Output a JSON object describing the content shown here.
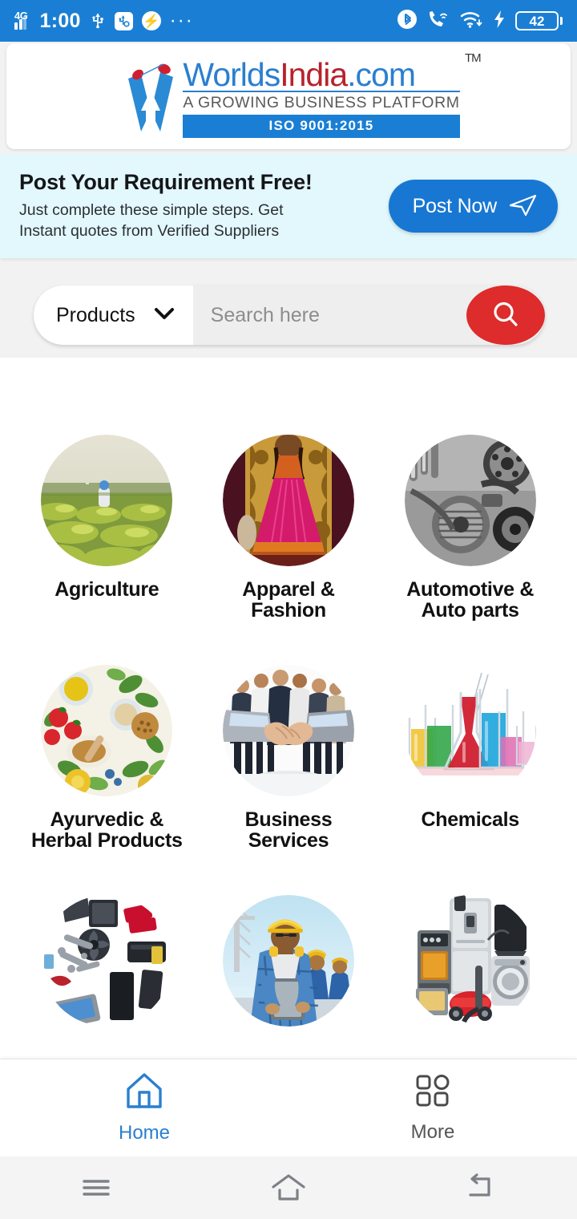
{
  "status_bar": {
    "network_type": "4G",
    "time": "1:00",
    "battery_level": "42",
    "overflow": "···",
    "icons": [
      "signal-icon",
      "usb-icon",
      "usb-debugging-icon",
      "messenger-icon",
      "overflow-dots-icon",
      "bluetooth-icon",
      "wifi-calling-icon",
      "wifi-icon",
      "charging-bolt-icon",
      "battery-icon"
    ],
    "bg_color": "#1a7fd4"
  },
  "header": {
    "brand_part1": "Worlds",
    "brand_part2": "India",
    "brand_part3": ".com",
    "trademark": "TM",
    "tagline": "A GROWING BUSINESS PLATFORM",
    "certification": "ISO 9001:2015",
    "brand_blue": "#2a7fd0",
    "brand_red": "#b8222b"
  },
  "promo": {
    "title": "Post Your Requirement Free!",
    "subtitle_line1": "Just complete these simple steps. Get",
    "subtitle_line2": "Instant quotes from Verified Suppliers",
    "button_label": "Post Now",
    "button_icon": "send-icon",
    "bg_color": "#e2f8fd",
    "button_color": "#1877d2"
  },
  "search": {
    "category_label": "Products",
    "dropdown_icon": "chevron-down-icon",
    "placeholder": "Search here",
    "value": "",
    "button_icon": "search-icon",
    "button_color": "#de2b2b"
  },
  "categories": [
    {
      "label": "Agriculture",
      "image": "agriculture-field-photo"
    },
    {
      "label": "Apparel & Fashion",
      "image": "apparel-lehenga-photo"
    },
    {
      "label": "Automotive & Auto parts",
      "image": "automotive-engine-photo"
    },
    {
      "label": "Ayurvedic & Herbal Products",
      "image": "ayurvedic-herbs-photo"
    },
    {
      "label": "Business Services",
      "image": "business-handshake-photo"
    },
    {
      "label": "Chemicals",
      "image": "chemicals-flasks-photo"
    },
    {
      "label": "",
      "image": "computer-hardware-photo"
    },
    {
      "label": "",
      "image": "construction-worker-photo"
    },
    {
      "label": "",
      "image": "home-appliances-photo"
    }
  ],
  "bottom_nav": [
    {
      "label": "Home",
      "icon": "home-icon",
      "active": true
    },
    {
      "label": "More",
      "icon": "grid-more-icon",
      "active": false
    }
  ],
  "system_nav": [
    {
      "icon": "recents-menu-icon"
    },
    {
      "icon": "home-icon"
    },
    {
      "icon": "back-icon"
    }
  ]
}
